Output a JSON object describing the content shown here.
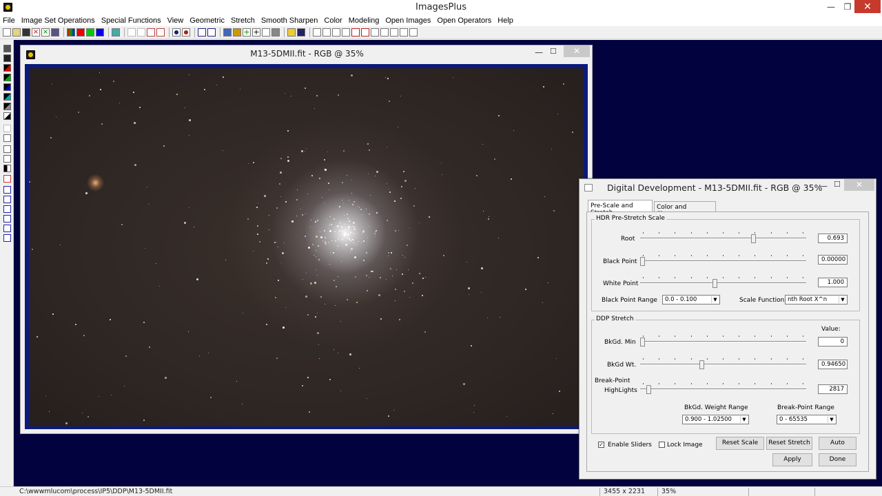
{
  "app": {
    "title": "ImagesPlus"
  },
  "menu": [
    "File",
    "Image Set Operations",
    "Special Functions",
    "View",
    "Geometric",
    "Stretch",
    "Smooth Sharpen",
    "Color",
    "Modeling",
    "Open Images",
    "Open Operators",
    "Help"
  ],
  "image_window": {
    "title": "M13-5DMII.fit - RGB @ 35%"
  },
  "dialog": {
    "title": "Digital Development - M13-5DMII.fit - RGB @ 35%",
    "tabs": [
      "Pre-Scale and Stretch",
      "Color and Sharpness"
    ],
    "hdr": {
      "title": "HDR Pre-Stretch Scale",
      "root": {
        "label": "Root",
        "value": "0.693",
        "level": 0.69
      },
      "black_point": {
        "label": "Black Point",
        "value": "0.00000",
        "level": 0.0
      },
      "white_point": {
        "label": "White Point",
        "value": "1.000",
        "level": 0.45
      },
      "black_point_range": {
        "label": "Black Point Range",
        "value": "0.0 - 0.100"
      },
      "scale_function": {
        "label": "Scale Function",
        "value": "nth Root X^n"
      }
    },
    "ddp": {
      "title": "DDP Stretch",
      "value_header": "Value:",
      "bkgd_min": {
        "label": "BkGd. Min",
        "value": "0",
        "level": 0.0
      },
      "bkgd_wt": {
        "label": "BkGd Wt.",
        "value": "0.94650",
        "level": 0.37
      },
      "break_point_line1": "Break-Point",
      "break_point": {
        "label": "HighLights",
        "value": "2817",
        "level": 0.04
      },
      "bkgd_weight_range": {
        "label": "BkGd. Weight Range",
        "value": "0.900 - 1.02500"
      },
      "break_point_range": {
        "label": "Break-Point Range",
        "value": "0 - 65535"
      }
    },
    "enable_sliders": {
      "label": "Enable Sliders",
      "checked": true
    },
    "lock_image": {
      "label": "Lock Image",
      "checked": false
    },
    "buttons": {
      "reset_scale": "Reset Scale",
      "reset_stretch": "Reset Stretch",
      "auto": "Auto",
      "apply": "Apply",
      "done": "Done"
    }
  },
  "status": {
    "path": "C:\\wwwmlucom\\process\\IP5\\DDP\\M13-5DMII.fit",
    "dims": "3455 x 2231",
    "zoom": "35%"
  }
}
